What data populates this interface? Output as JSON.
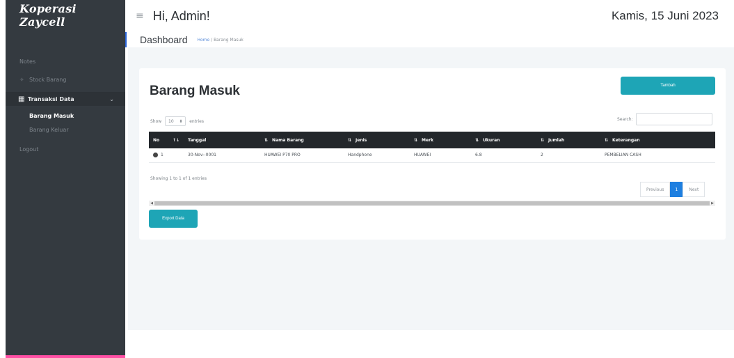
{
  "sidebar": {
    "brand": "Koperasi Zaycell",
    "items": [
      {
        "label": "Notes",
        "icon": "none"
      },
      {
        "label": "Stock Barang",
        "icon": "star-icon"
      },
      {
        "label": "Transaksi Data",
        "icon": "table-icon",
        "expanded": true
      },
      {
        "label": "Barang Masuk",
        "active": true
      },
      {
        "label": "Barang Keluar"
      },
      {
        "label": "Logout"
      }
    ],
    "chevron": "⌄",
    "star_glyph": "✧",
    "table_glyph": "▦"
  },
  "topbar": {
    "menu_glyph": "≡",
    "greeting": "Hi, Admin!",
    "date": "Kamis, 15 Juni 2023"
  },
  "breadcrumb": {
    "title": "Dashboard",
    "home": "Home",
    "separator": " / ",
    "current": "Barang Masuk"
  },
  "card": {
    "title": "Barang Masuk",
    "add_button": "Tambah",
    "show_label": "Show",
    "entries_value": "10",
    "entries_label": "entries",
    "search_label": "Search:",
    "search_value": "",
    "columns": [
      "No",
      "Tanggal",
      "Nama Barang",
      "Jenis",
      "Merk",
      "Ukuran",
      "Jumlah",
      "Keterangan"
    ],
    "rows": [
      {
        "no": "1",
        "tanggal": "30-Nov--0001",
        "nama": "HUAWEI P70 PRO",
        "jenis": "Handphone",
        "merk": "HUAWEI",
        "ukuran": "6.8",
        "jumlah": "2",
        "keterangan": "PEMBELIAN CASH"
      }
    ],
    "showing": "Showing 1 to 1 of 1 entries",
    "pager": {
      "previous": "Previous",
      "page": "1",
      "next": "Next"
    },
    "export_button": "Export Data"
  },
  "colors": {
    "sidebar_bg": "#343a40",
    "accent_teal": "#1ea5b6",
    "page_active": "#1e7fe0",
    "table_header": "#23272b",
    "bottom_bar": "#ff4fa5"
  }
}
